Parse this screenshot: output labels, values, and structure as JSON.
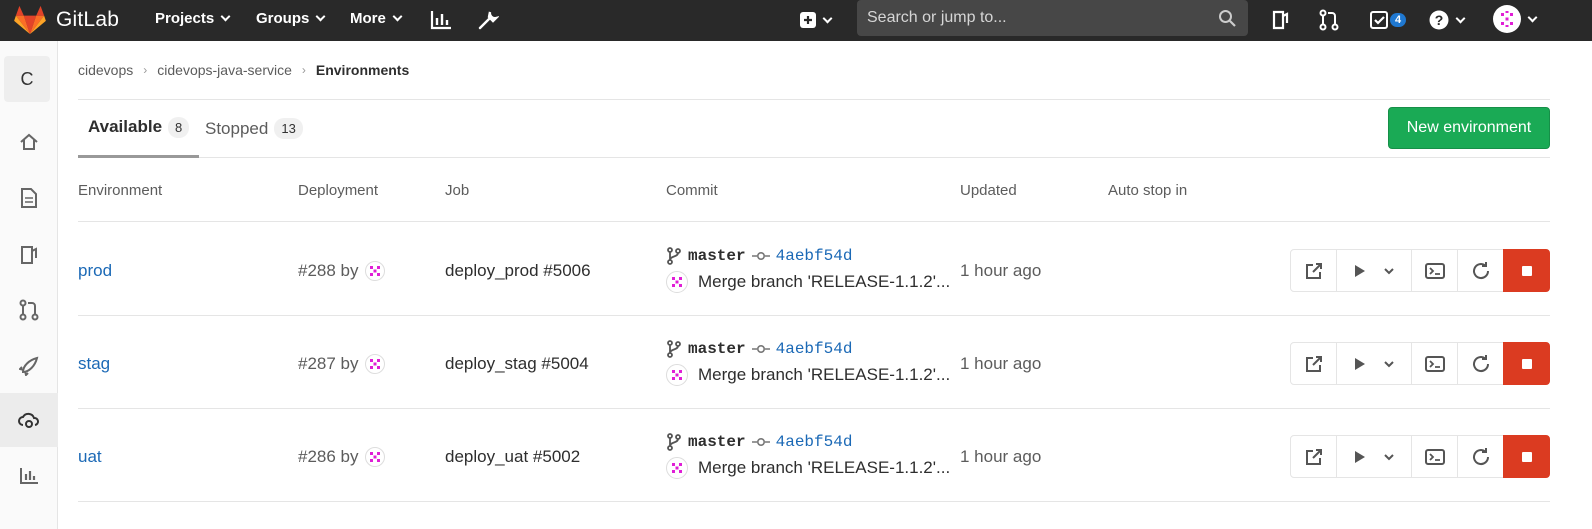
{
  "topbar": {
    "brand": "GitLab",
    "nav": [
      "Projects",
      "Groups",
      "More"
    ],
    "search_placeholder": "Search or jump to...",
    "todo_count": "4"
  },
  "sidebar": {
    "project_letter": "C"
  },
  "breadcrumb": [
    "cidevops",
    "cidevops-java-service",
    "Environments"
  ],
  "tabs": [
    {
      "label": "Available",
      "count": "8"
    },
    {
      "label": "Stopped",
      "count": "13"
    }
  ],
  "new_env_label": "New environment",
  "columns": [
    "Environment",
    "Deployment",
    "Job",
    "Commit",
    "Updated",
    "Auto stop in"
  ],
  "rows": [
    {
      "env": "prod",
      "deploy": "#288 by",
      "job": "deploy_prod #5006",
      "ref": "master",
      "sha": "4aebf54d",
      "msg": "Merge branch 'RELEASE-1.1.2'...",
      "updated": "1 hour ago"
    },
    {
      "env": "stag",
      "deploy": "#287 by",
      "job": "deploy_stag #5004",
      "ref": "master",
      "sha": "4aebf54d",
      "msg": "Merge branch 'RELEASE-1.1.2'...",
      "updated": "1 hour ago"
    },
    {
      "env": "uat",
      "deploy": "#286 by",
      "job": "deploy_uat #5002",
      "ref": "master",
      "sha": "4aebf54d",
      "msg": "Merge branch 'RELEASE-1.1.2'...",
      "updated": "1 hour ago"
    }
  ],
  "colors": {
    "link": "#1b69b6",
    "success": "#1aaa55",
    "danger": "#db3b21",
    "nav": "#292929"
  }
}
